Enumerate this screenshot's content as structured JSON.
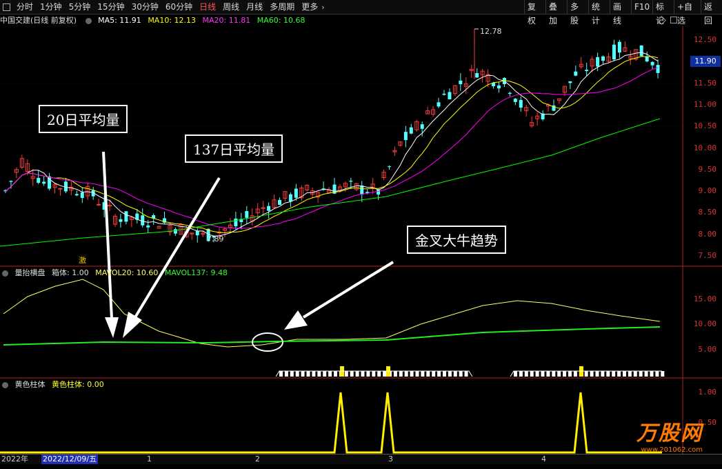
{
  "toolbar": {
    "periods": [
      "分时",
      "1分钟",
      "5分钟",
      "15分钟",
      "30分钟",
      "60分钟",
      "日线",
      "周线",
      "月线",
      "多周期",
      "更多"
    ],
    "active_period": "日线",
    "buttons": [
      "复权",
      "叠加",
      "多股",
      "统计",
      "画线",
      "F10",
      "标记",
      "+自选",
      "返回"
    ]
  },
  "main_legend": {
    "title": "中国交建(日线 前复权)",
    "ma5": "MA5: 11.91",
    "ma10": "MA10: 12.13",
    "ma20": "MA20: 11.81",
    "ma60": "MA60: 10.68",
    "colors": {
      "ma5": "#ffffff",
      "ma10": "#ffff00",
      "ma20": "#ff00ff",
      "ma60": "#00ff00"
    }
  },
  "price_axis": [
    "12.50",
    "12.00",
    "11.50",
    "11.00",
    "10.50",
    "10.00",
    "9.50",
    "9.00",
    "8.50",
    "8.00",
    "7.50"
  ],
  "current_price": "11.90",
  "high_marker": "12.78",
  "low_marker": "7.89",
  "event_mark": "激",
  "vol_legend": {
    "title": "量抬横盘",
    "box": "箱体: 1.00",
    "mavol20": "MAVOL20: 10.60",
    "mavol137": "MAVOL137: 9.48"
  },
  "vol_axis": [
    "15.00",
    "10.00",
    "5.00"
  ],
  "bar_legend": {
    "title": "黄色柱体",
    "value": "黄色柱体: 0.00"
  },
  "bar_axis": [
    "1.00",
    "0.50"
  ],
  "callouts": {
    "c20": "20日平均量",
    "c137": "137日平均量",
    "golden": "金叉大牛趋势"
  },
  "dates": {
    "year": "2022年",
    "selected": "2022/12/09/五",
    "m1": "1",
    "m2": "2",
    "m3": "3",
    "m4": "4"
  },
  "watermark": {
    "brand": "万股网",
    "url": "www.201062.com"
  },
  "colors": {
    "up": "#ff3b3b",
    "down": "#54ffff",
    "axis": "#b02020"
  }
}
